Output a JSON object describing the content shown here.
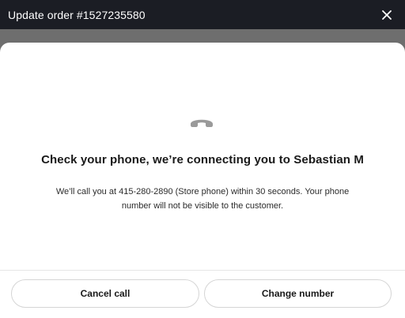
{
  "window": {
    "title": "Update order #1527235580",
    "close_icon": "close-icon"
  },
  "modal": {
    "status_icon": "phone-hangup-icon",
    "heading": "Check your phone, we’re connecting you to Sebastian M",
    "description": "We’ll call you at 415-280-2890 (Store phone) within 30 seconds. Your phone number will not be visible to the customer.",
    "buttons": {
      "cancel_label": "Cancel call",
      "change_label": "Change number"
    }
  },
  "colors": {
    "titlebar": "#1b1d24",
    "icon_gray": "#9a9a9a",
    "text_dark": "#191919"
  }
}
